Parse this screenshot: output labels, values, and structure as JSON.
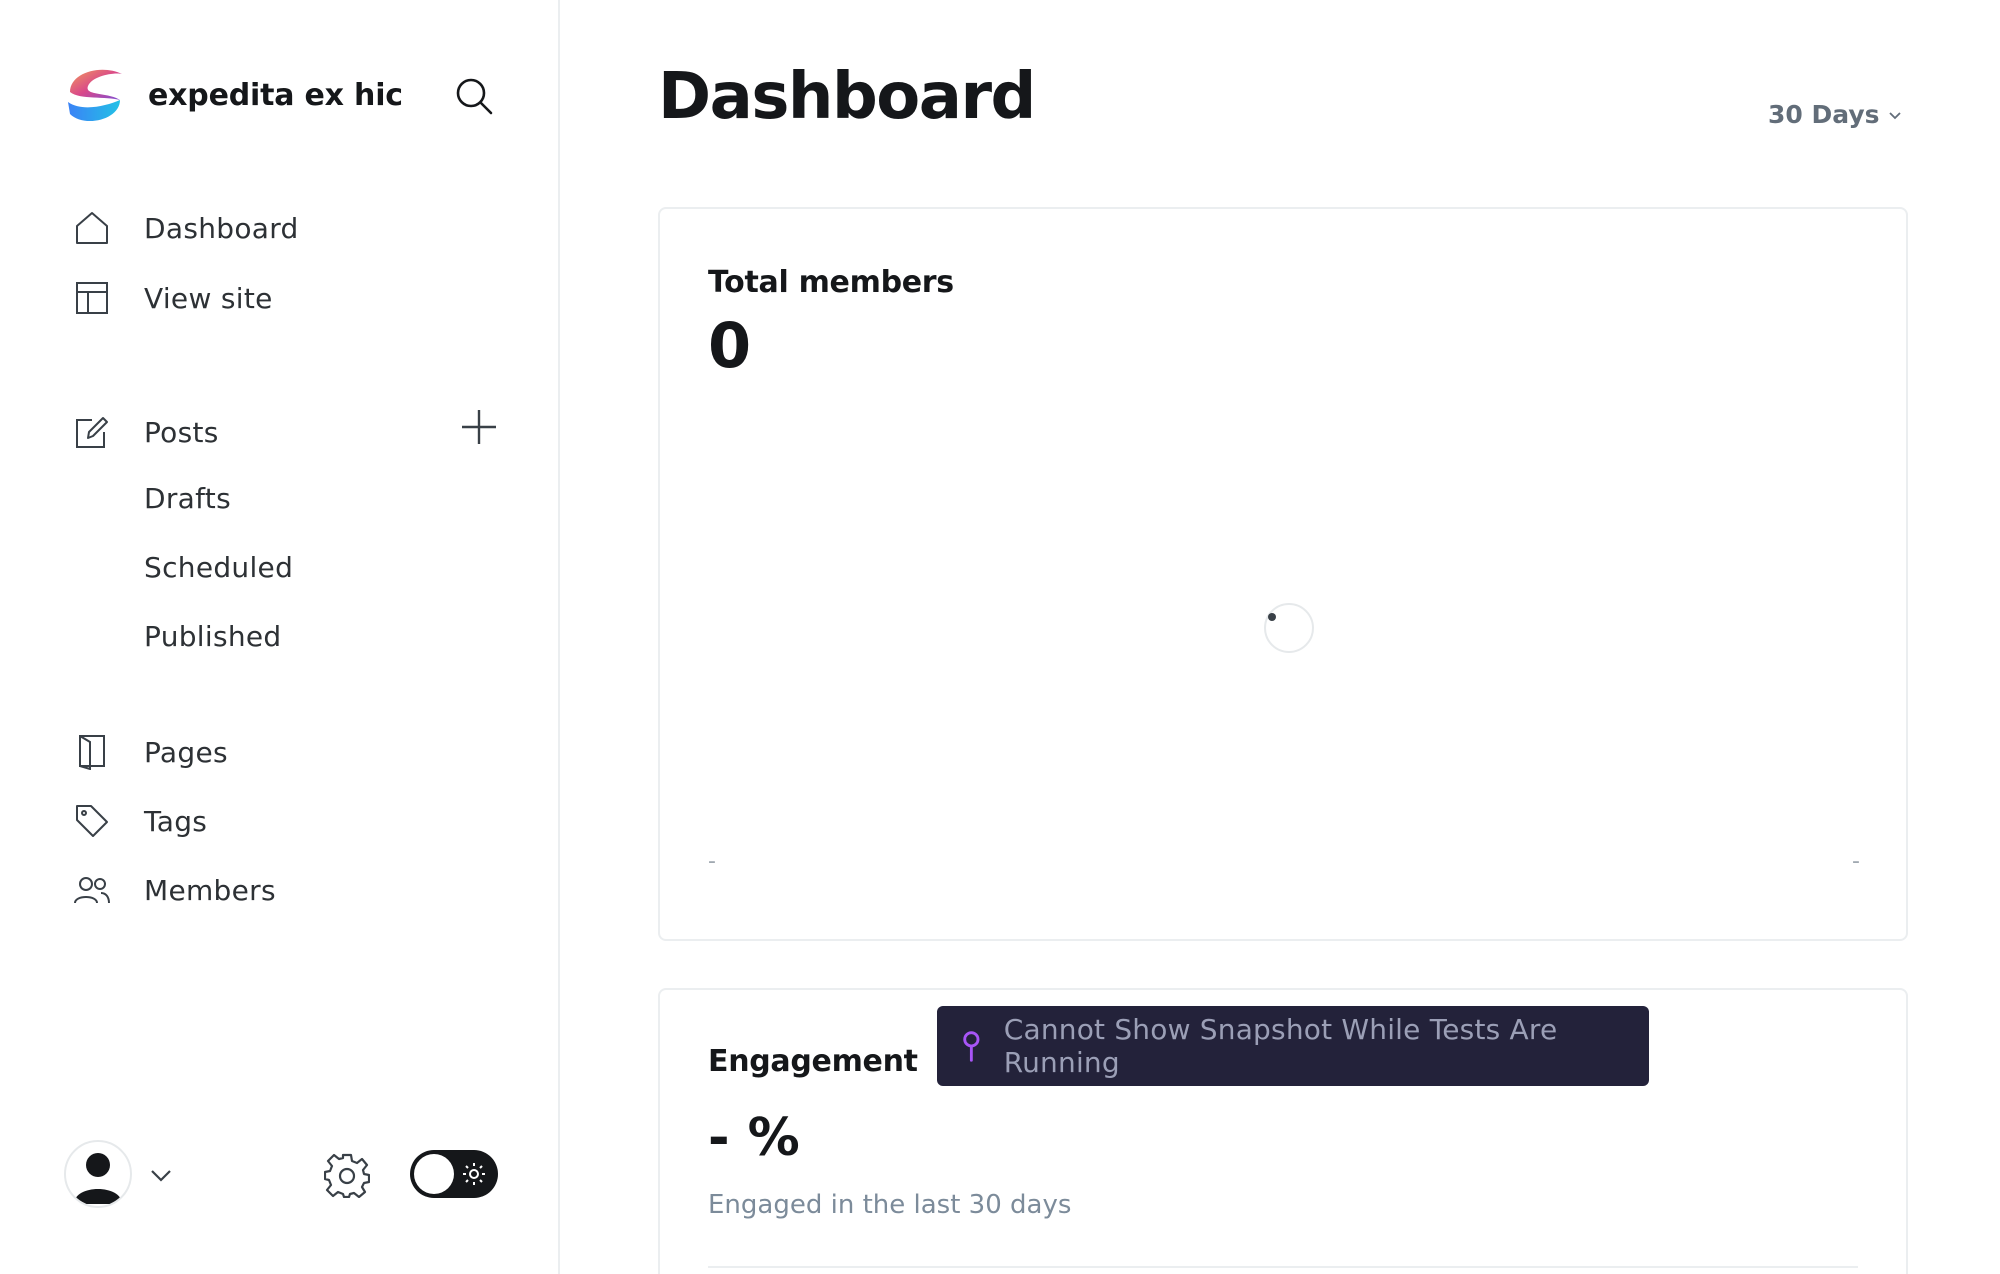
{
  "brand": {
    "name": "expedita ex hic"
  },
  "sidebar": {
    "primary": [
      {
        "label": "Dashboard",
        "icon": "home-icon"
      },
      {
        "label": "View site",
        "icon": "layout-icon"
      }
    ],
    "posts": {
      "label": "Posts",
      "icon": "edit-icon"
    },
    "post_subitems": [
      "Drafts",
      "Scheduled",
      "Published"
    ],
    "secondary": [
      {
        "label": "Pages",
        "icon": "page-icon"
      },
      {
        "label": "Tags",
        "icon": "tag-icon"
      },
      {
        "label": "Members",
        "icon": "members-icon"
      }
    ]
  },
  "header": {
    "title": "Dashboard",
    "range": "30 Days"
  },
  "members_card": {
    "title": "Total members",
    "value": "0",
    "x_start": "-",
    "x_end": "-"
  },
  "engagement_card": {
    "title": "Engagement",
    "value": "- %",
    "subtitle": "Engaged in the last 30 days"
  },
  "banner": {
    "message": "Cannot Show Snapshot While Tests Are Running"
  },
  "colors": {
    "text": "#15171a",
    "muted": "#7c8b9a",
    "banner_bg": "#23223a",
    "banner_pin": "#a855f7"
  }
}
